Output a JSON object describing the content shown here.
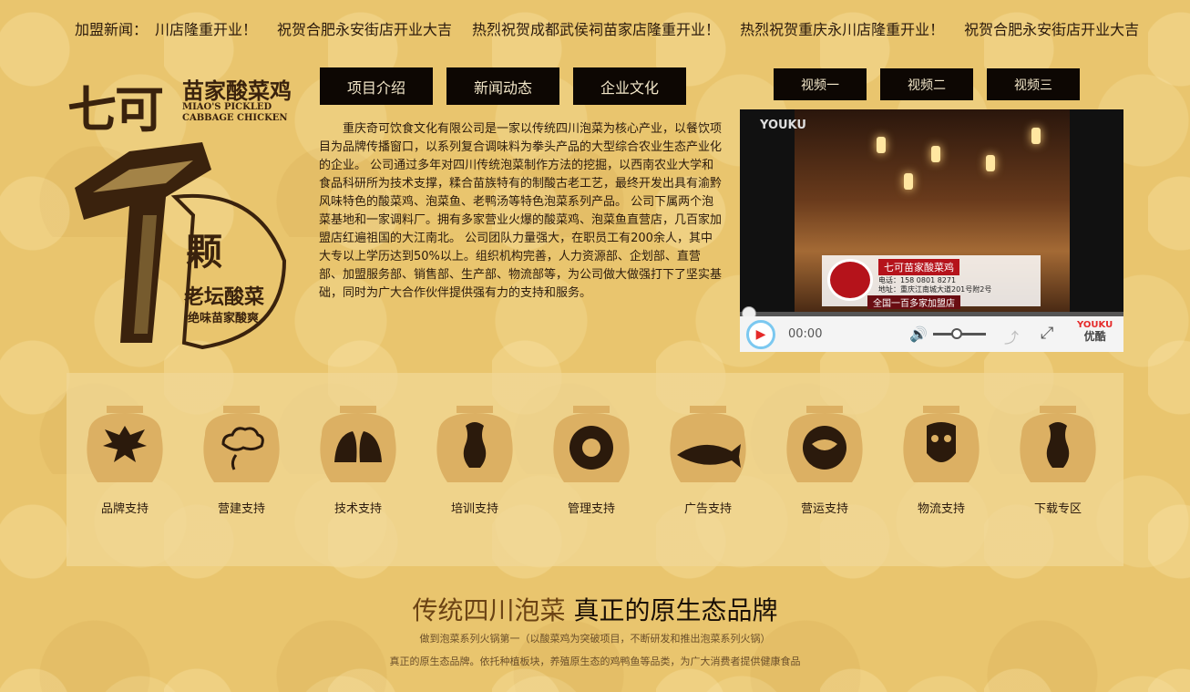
{
  "ticker": {
    "label": "加盟新闻：",
    "items": [
      "川店隆重开业！",
      "祝贺合肥永安街店开业大吉",
      "热烈祝贺成都武侯祠苗家店隆重开业！",
      "热烈祝贺重庆永川店隆重开业！",
      "祝贺合肥永安街店开业大吉"
    ]
  },
  "logo": {
    "brand": "七可",
    "cn_name": "苗家酸菜鸡",
    "en_line1": "MIAO'S PICKLED",
    "en_line2": "CABBAGE CHICKEN",
    "ke": "颗",
    "laotan": "老坛酸菜",
    "tagline": "绝味苗家酸爽"
  },
  "nav": [
    "项目介绍",
    "新闻动态",
    "企业文化"
  ],
  "intro": "重庆奇可饮食文化有限公司是一家以传统四川泡菜为核心产业，以餐饮项目为品牌传播窗口，以系列复合调味料为拳头产品的大型综合农业生态产业化的企业。 公司通过多年对四川传统泡菜制作方法的挖掘，以西南农业大学和食品科研所为技术支撑，糅合苗族特有的制酸古老工艺，最终开发出具有渝黔风味特色的酸菜鸡、泡菜鱼、老鸭汤等特色泡菜系列产品。 公司下属两个泡菜基地和一家调料厂。拥有多家营业火爆的酸菜鸡、泡菜鱼直营店，几百家加盟店红遍祖国的大江南北。 公司团队力量强大，在职员工有200余人，其中大专以上学历达到50%以上。组织机构完善，人力资源部、企划部、直营部、加盟服务部、销售部、生产部、物流部等，为公司做大做强打下了坚实基础，同时为广大合作伙伴提供强有力的支持和服务。",
  "video_tabs": [
    "视频一",
    "视频二",
    "视频三"
  ],
  "player": {
    "watermark": "YOUKU",
    "overlay_title": "七可苗家酸菜鸡",
    "overlay_line1": "电话：158 0801 8271",
    "overlay_line2": "地址：重庆江南城大道201号附2号",
    "overlay_banner": "全国一百多家加盟店",
    "time": "00:00",
    "brand_en": "YOUKU",
    "brand_cn": "优酷"
  },
  "services": [
    "品牌支持",
    "营建支持",
    "技术支持",
    "培训支持",
    "管理支持",
    "广告支持",
    "营运支持",
    "物流支持",
    "下载专区"
  ],
  "slogan": {
    "part1": "传统四川泡菜",
    "part2": "真正的原生态品牌"
  },
  "sub1": "做到泡菜系列火锅第一（以酸菜鸡为突破项目，不断研发和推出泡菜系列火锅）",
  "sub2": "真正的原生态品牌。依托种植板块，养殖原生态的鸡鸭鱼等品类，为广大消费者提供健康食品",
  "colors": {
    "button_bg": "#0d0703",
    "button_text": "#f3e7c9",
    "page_bg": "#e9c56e",
    "accent_red": "#b5131b"
  }
}
